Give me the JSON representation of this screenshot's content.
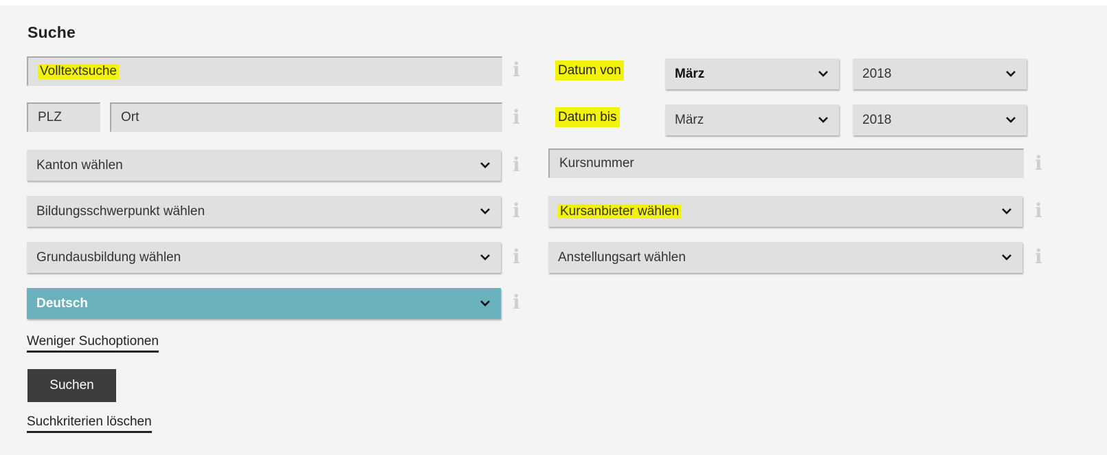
{
  "section_title": "Suche",
  "fulltext": {
    "placeholder": "Volltextsuche"
  },
  "zip": {
    "placeholder": "PLZ"
  },
  "city": {
    "placeholder": "Ort"
  },
  "canton": {
    "value": "Kanton wählen"
  },
  "focus": {
    "value": "Bildungsschwerpunkt wählen"
  },
  "basic_training": {
    "value": "Grundausbildung wählen"
  },
  "language": {
    "value": "Deutsch"
  },
  "date_from": {
    "label": "Datum von",
    "month": "März",
    "year": "2018"
  },
  "date_to": {
    "label": "Datum bis",
    "month": "März",
    "year": "2018"
  },
  "course_number": {
    "placeholder": "Kursnummer"
  },
  "provider": {
    "value": "Kursanbieter wählen"
  },
  "employment_type": {
    "value": "Anstellungsart wählen"
  },
  "info_glyph": "i",
  "less_options_link": "Weniger Suchoptionen",
  "search_button": "Suchen",
  "clear_link": "Suchkriterien löschen",
  "colors": {
    "highlight": "#f2f20a",
    "language_select": "#68b1bd",
    "search_button": "#3d3d3d"
  }
}
